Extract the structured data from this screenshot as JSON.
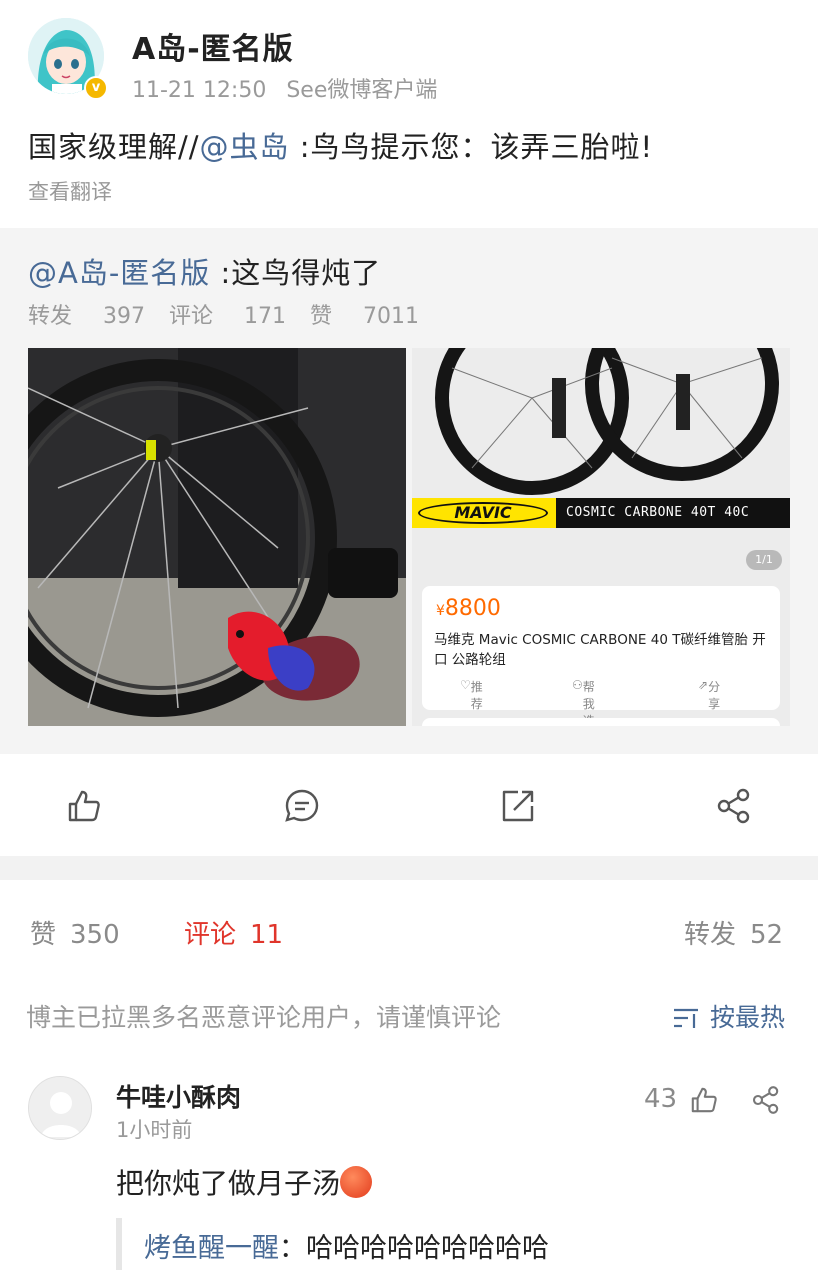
{
  "post": {
    "author": "A岛-匿名版",
    "time": "11-21 12:50",
    "source": "See微博客户端",
    "verified_badge": "v",
    "text_prefix": "国家级理解//",
    "mention": "@虫岛",
    "text_suffix": " :鸟鸟提示您：该弄三胎啦!",
    "translate_label": "查看翻译"
  },
  "repost": {
    "mention": "@A岛-匿名版",
    "text": " :这鸟得炖了",
    "stats": {
      "repost_label": "转发",
      "repost_count": "397",
      "comment_label": "评论",
      "comment_count": "171",
      "like_label": "赞",
      "like_count": "7011"
    },
    "product": {
      "brand": "MAVIC",
      "model_band": "COSMIC CARBONE 40T 40C",
      "page_indicator": "1/1",
      "price_symbol": "¥",
      "price": "8800",
      "title": "马维克 Mavic COSMIC CARBONE 40 T碳纤维管胎 开口 公路轮组",
      "action_recommend": "推荐",
      "action_help": "帮我选",
      "action_share": "分享"
    }
  },
  "action_bar": {
    "icons": [
      "like-icon",
      "comment-icon",
      "repost-icon",
      "share-icon"
    ]
  },
  "tabs": {
    "likes_label": "赞",
    "likes_count": "350",
    "comments_label": "评论",
    "comments_count": "11",
    "reposts_label": "转发",
    "reposts_count": "52"
  },
  "notice": "博主已拉黑多名恶意评论用户，请谨慎评论",
  "sort_label": "按最热",
  "comment": {
    "user": "牛哇小酥肉",
    "time": "1小时前",
    "like_count": "43",
    "text": "把你炖了做月子汤",
    "reply_user": "烤鱼醒一醒",
    "reply_text": "：哈哈哈哈哈哈哈哈哈"
  },
  "colors": {
    "link_blue": "#486a96",
    "active_red": "#e0352b",
    "price_orange": "#ff6a00",
    "verified_gold": "#f5b800"
  }
}
